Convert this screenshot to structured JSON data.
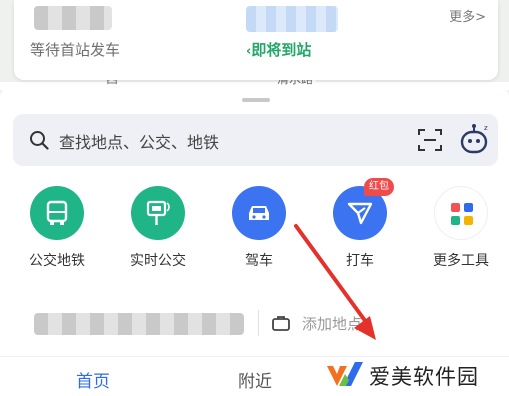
{
  "status_card": {
    "waiting_text": "等待首站发车",
    "arriving_text": "即将到站",
    "more_label": "更多>"
  },
  "map": {
    "labels": [
      "西",
      "清水路"
    ]
  },
  "search": {
    "placeholder": "查找地点、公交、地铁",
    "scan_icon": "scan-icon",
    "assistant_icon": "robot-assistant-icon"
  },
  "tools": [
    {
      "label": "公交地铁",
      "icon": "bus-icon",
      "color": "#1fb587"
    },
    {
      "label": "实时公交",
      "icon": "bus-stop-sign-icon",
      "color": "#1fb587"
    },
    {
      "label": "驾车",
      "icon": "car-icon",
      "color": "#3b73f0"
    },
    {
      "label": "打车",
      "icon": "taxi-arrow-icon",
      "color": "#3b73f0",
      "badge": "红包"
    },
    {
      "label": "更多工具",
      "icon": "grid-tools-icon",
      "color": "#ffffff"
    }
  ],
  "address": {
    "add_place": "添加地点"
  },
  "tabs": {
    "home": "首页",
    "nearby": "附近"
  },
  "watermark": {
    "text": "爱美软件园"
  },
  "colors": {
    "accent_blue": "#2f6bea",
    "accent_green": "#23a66a",
    "arrow_red": "#e5312b"
  }
}
